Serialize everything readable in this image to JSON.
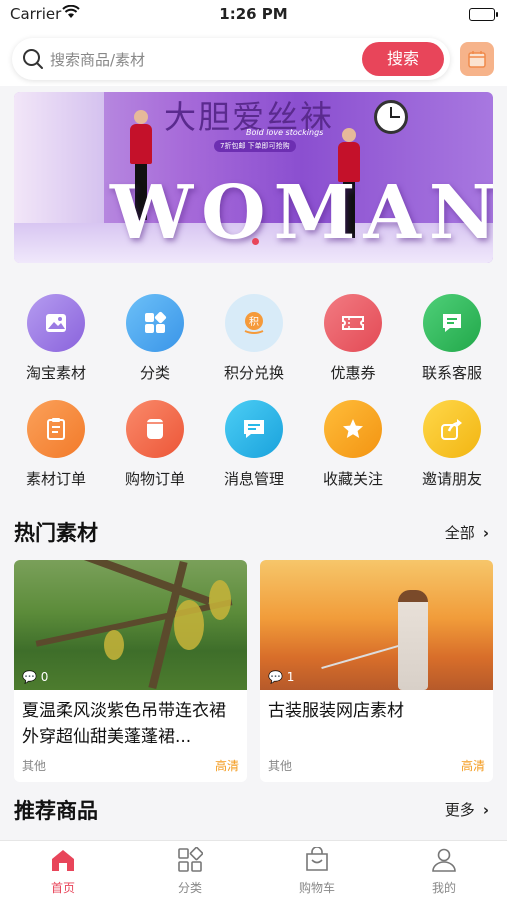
{
  "status_bar": {
    "carrier": "Carrier",
    "time": "1:26 PM"
  },
  "header": {
    "search_placeholder": "搜索商品/素材",
    "search_button": "搜索",
    "calendar_icon": "calendar-icon"
  },
  "banner": {
    "headline": "大胆爱丝袜",
    "subline": "Bold love stockings",
    "pill": "7折包邮  下单即可抢购",
    "big_word": "WOMAN"
  },
  "grid": {
    "items": [
      {
        "label": "淘宝素材",
        "icon": "image-icon",
        "color": "#9b7be3"
      },
      {
        "label": "分类",
        "icon": "category-grid-icon",
        "color": "#4aa8f0"
      },
      {
        "label": "积分兑换",
        "icon": "points-icon",
        "color": "#d4e8f8"
      },
      {
        "label": "优惠券",
        "icon": "coupon-icon",
        "color": "#ea5662"
      },
      {
        "label": "联系客服",
        "icon": "chat-icon",
        "color": "#2fbd5a"
      },
      {
        "label": "素材订单",
        "icon": "order-clipboard-icon",
        "color": "#f58a3a"
      },
      {
        "label": "购物订单",
        "icon": "shopping-order-icon",
        "color": "#f26b4a"
      },
      {
        "label": "消息管理",
        "icon": "message-icon",
        "color": "#28b8e8"
      },
      {
        "label": "收藏关注",
        "icon": "star-icon",
        "color": "#f8a51c"
      },
      {
        "label": "邀请朋友",
        "icon": "share-icon",
        "color": "#f6c419"
      }
    ]
  },
  "hot_section": {
    "title": "热门素材",
    "more": "全部"
  },
  "cards": [
    {
      "title": "夏温柔风淡紫色吊带连衣裙外穿超仙甜美蓬蓬裙...",
      "count": "0",
      "category": "其他",
      "quality": "高清"
    },
    {
      "title": "古装服装网店素材",
      "count": "1",
      "category": "其他",
      "quality": "高清"
    }
  ],
  "recommend_section": {
    "title": "推荐商品",
    "more": "更多"
  },
  "tabbar": {
    "items": [
      {
        "label": "首页",
        "icon": "home-icon",
        "active": true
      },
      {
        "label": "分类",
        "icon": "category-icon",
        "active": false
      },
      {
        "label": "购物车",
        "icon": "cart-icon",
        "active": false
      },
      {
        "label": "我的",
        "icon": "profile-icon",
        "active": false
      }
    ]
  },
  "colors": {
    "accent": "#e8455a",
    "quality": "#f39a1c"
  }
}
